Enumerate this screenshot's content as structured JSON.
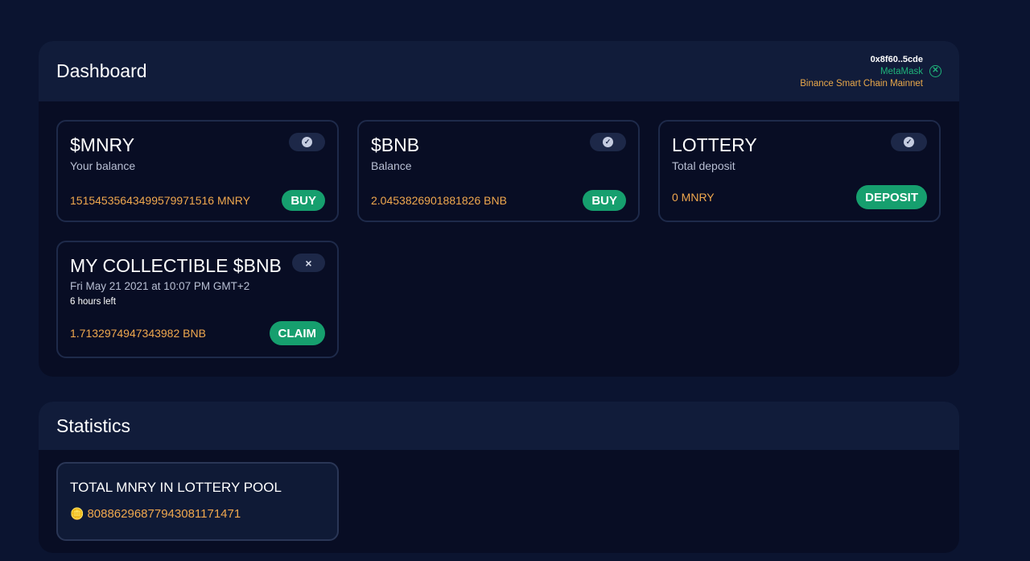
{
  "dashboard": {
    "title": "Dashboard",
    "wallet": {
      "address": "0x8f60..5cde",
      "provider": "MetaMask",
      "network": "Binance Smart Chain Mainnet"
    },
    "cards": {
      "mnry": {
        "title": "$MNRY",
        "subtitle": "Your balance",
        "value": "15154535643499579971516 MNRY",
        "button": "BUY",
        "status_icon": "check-icon"
      },
      "bnb": {
        "title": "$BNB",
        "subtitle": "Balance",
        "value": "2.0453826901881826 BNB",
        "button": "BUY",
        "status_icon": "check-icon"
      },
      "lottery": {
        "title": "LOTTERY",
        "subtitle": "Total deposit",
        "value": "0 MNRY",
        "button": "DEPOSIT",
        "status_icon": "check-icon"
      },
      "collectible": {
        "title": "MY COLLECTIBLE $BNB",
        "subtitle": "Fri May 21 2021 at 10:07 PM GMT+2",
        "note": "6 hours left",
        "value": "1.7132974947343982 BNB",
        "button": "CLAIM",
        "status_icon": "close-icon"
      }
    }
  },
  "statistics": {
    "title": "Statistics",
    "lottery_pool": {
      "title": "TOTAL MNRY IN LOTTERY POOL",
      "value": "8088629687794308117147​1",
      "icon": "coins-icon"
    }
  },
  "colors": {
    "background": "#0b1430",
    "panel": "#080d24",
    "header": "#111c3a",
    "accent_green": "#169f6e",
    "value_orange": "#f0a84e"
  }
}
